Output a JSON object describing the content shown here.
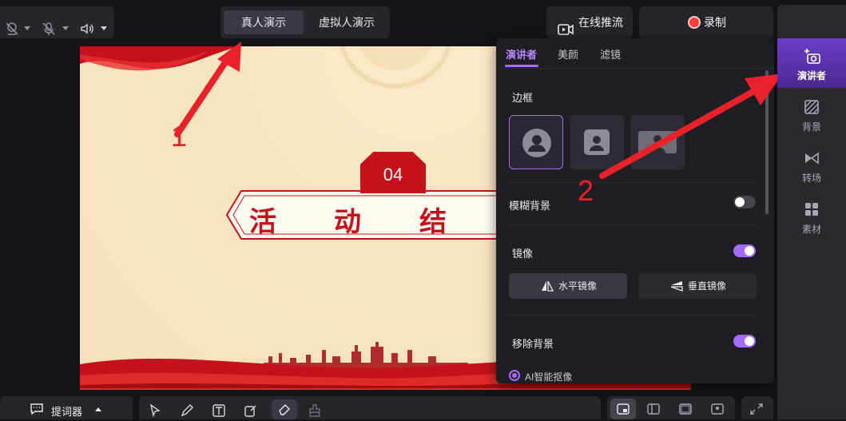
{
  "toolbar": {
    "modes": [
      "真人演示",
      "虚拟人演示"
    ],
    "live_push_label": "在线推流",
    "record_label": "录制"
  },
  "slide": {
    "number": "04",
    "banner_chars": [
      "活",
      "动",
      "结"
    ]
  },
  "panel": {
    "tabs": [
      "演讲者",
      "美颜",
      "滤镜"
    ],
    "active_tab": "演讲者",
    "frame_label": "边框",
    "blur_bg_label": "模糊背景",
    "blur_bg_on": false,
    "mirror_label": "镜像",
    "mirror_on": true,
    "mirror_options": [
      "水平镜像",
      "垂直镜像"
    ],
    "remove_bg_label": "移除背景",
    "remove_bg_on": true,
    "ai_cutout_label": "AI智能抠像"
  },
  "rail": {
    "items": [
      {
        "label": "演讲者",
        "icon": "presenter-camera-icon",
        "active": true
      },
      {
        "label": "背景",
        "icon": "background-icon",
        "active": false
      },
      {
        "label": "转场",
        "icon": "transition-icon",
        "active": false
      },
      {
        "label": "素材",
        "icon": "materials-icon",
        "active": false
      }
    ]
  },
  "bottom": {
    "prompter_label": "提词器"
  },
  "annotations": [
    "1",
    "2"
  ],
  "colors": {
    "accent": "#a46bff",
    "record_red": "#ff3b3b",
    "annotation_red": "#e8212a",
    "slide_red": "#c4111b"
  }
}
